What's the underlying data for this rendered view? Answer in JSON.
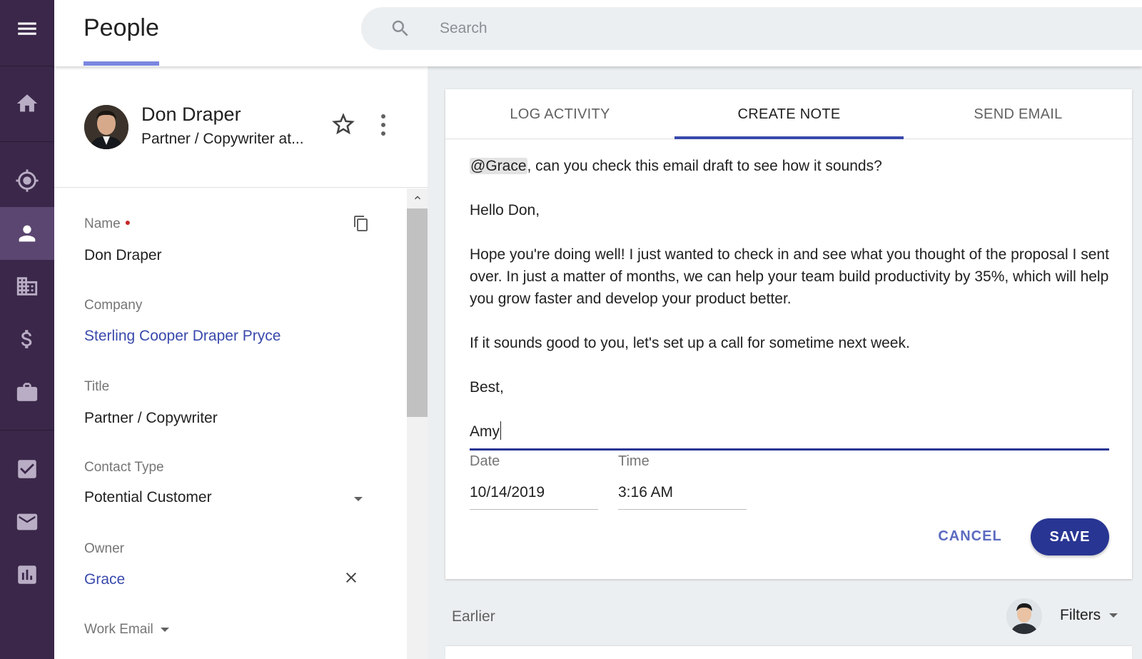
{
  "header": {
    "title": "People",
    "search_placeholder": "Search"
  },
  "sidebar": {
    "items": [
      {
        "icon": "home-icon"
      },
      {
        "icon": "target-icon"
      },
      {
        "icon": "person-icon",
        "active": true
      },
      {
        "icon": "building-icon"
      },
      {
        "icon": "dollar-icon"
      },
      {
        "icon": "briefcase-icon"
      },
      {
        "icon": "checkbox-icon"
      },
      {
        "icon": "mail-icon"
      },
      {
        "icon": "bar-chart-icon"
      }
    ]
  },
  "contact": {
    "name": "Don Draper",
    "subtitle": "Partner / Copywriter at..."
  },
  "fields": {
    "name_label": "Name",
    "name_value": "Don Draper",
    "company_label": "Company",
    "company_value": "Sterling Cooper Draper Pryce",
    "title_label": "Title",
    "title_value": "Partner / Copywriter",
    "contact_type_label": "Contact Type",
    "contact_type_value": "Potential Customer",
    "owner_label": "Owner",
    "owner_value": "Grace",
    "work_email_label": "Work Email"
  },
  "note": {
    "tabs": [
      {
        "label": "LOG ACTIVITY",
        "active": false
      },
      {
        "label": "CREATE NOTE",
        "active": true
      },
      {
        "label": "SEND EMAIL",
        "active": false
      }
    ],
    "mention": "@Grace",
    "line1_rest": ", can you check this email draft to see how it sounds?",
    "greeting": "Hello Don,",
    "para1": "Hope you're doing well! I just wanted to check in and see what you thought of the proposal I sent over. In just a matter of months, we can help your team build productivity by 35%, which will help you grow faster and develop your product better.",
    "para2": "If it sounds good to you, let's set up a call for sometime next week.",
    "signoff": "Best,",
    "signature": "Amy",
    "date_label": "Date",
    "date_value": "10/14/2019",
    "time_label": "Time",
    "time_value": "3:16 AM",
    "cancel_label": "CANCEL",
    "save_label": "SAVE"
  },
  "earlier": {
    "label": "Earlier",
    "filters_label": "Filters"
  },
  "colors": {
    "sidebar_bg": "#3a2749",
    "accent": "#283593",
    "link": "#3949ab"
  }
}
